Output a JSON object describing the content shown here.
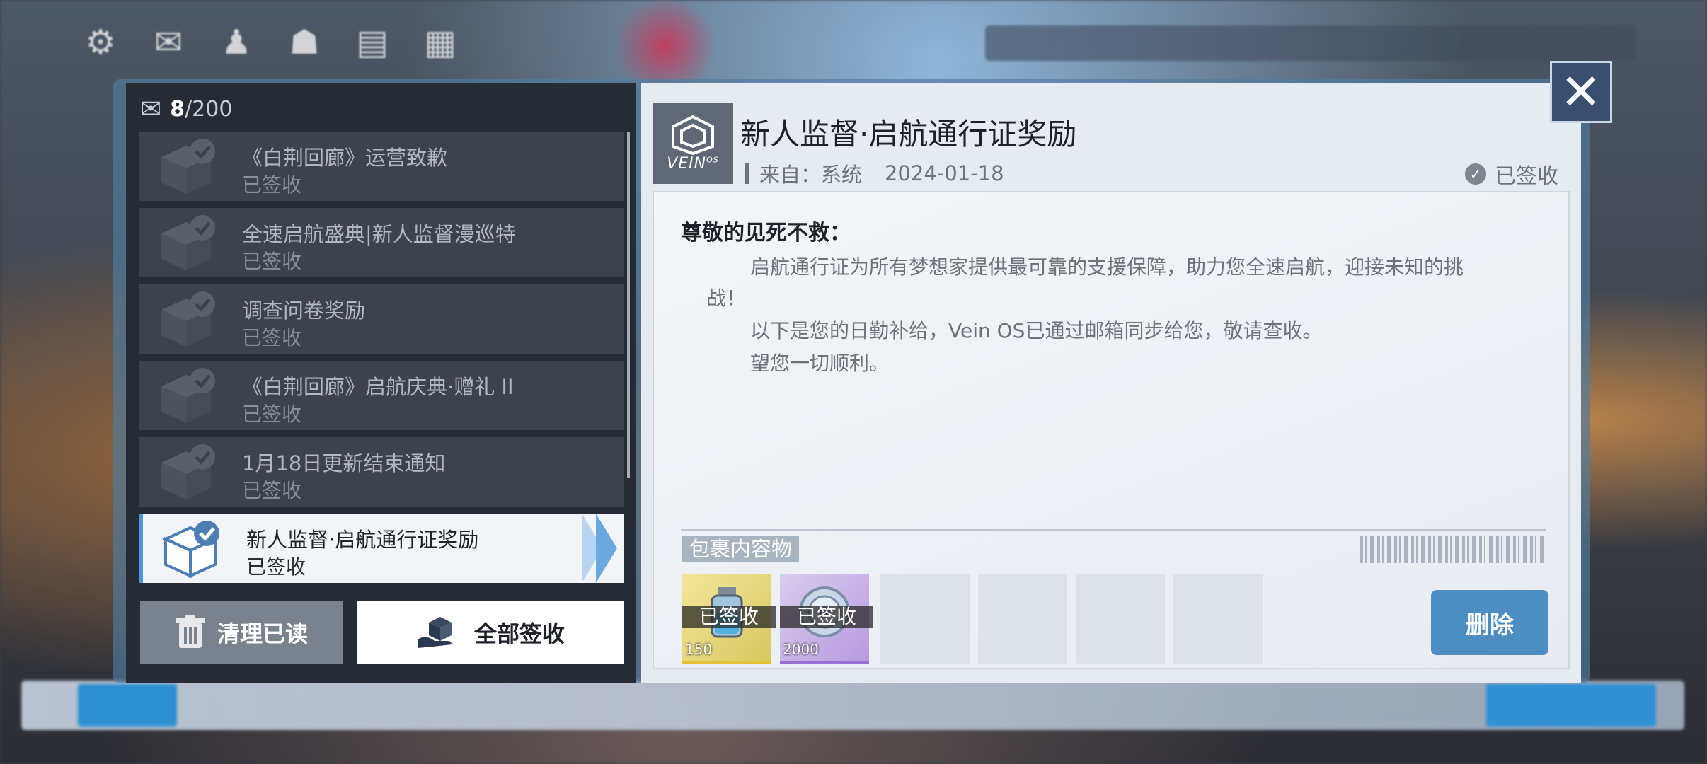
{
  "mailbox": {
    "count_current": "8",
    "count_total": "/200"
  },
  "mails": [
    {
      "title": "《白荆回廊》运营致歉",
      "status": "已签收",
      "active": false
    },
    {
      "title": "全速启航盛典|新人监督漫巡特",
      "status": "已签收",
      "active": false
    },
    {
      "title": "调查问卷奖励",
      "status": "已签收",
      "active": false
    },
    {
      "title": "《白荆回廊》启航庆典·赠礼 II",
      "status": "已签收",
      "active": false
    },
    {
      "title": "1月18日更新结束通知",
      "status": "已签收",
      "active": false
    },
    {
      "title": "新人监督·启航通行证奖励",
      "status": "已签收",
      "active": true
    }
  ],
  "buttons": {
    "clear_read": "清理已读",
    "claim_all": "全部签收",
    "delete": "删除"
  },
  "detail": {
    "logo_text": "VEIN",
    "logo_sup": "OS",
    "title": "新人监督·启航通行证奖励",
    "from_label": "来自：",
    "from_value": "系统",
    "date": "2024-01-18",
    "signed_status": "已签收",
    "greeting": "尊敬的见死不救：",
    "para1_line1": "启航通行证为所有梦想家提供最可靠的支援保障，助力您全速启航，迎接未知的挑",
    "para1_line2": "战！",
    "para2": "以下是您的日勤补给，Vein OS已通过邮箱同步给您，敬请查收。",
    "para3": "望您一切顺利。",
    "package_label": "包裹内容物"
  },
  "package_items": [
    {
      "overlay": "已签收",
      "qty": "150",
      "rarity_color": "#e4c33a"
    },
    {
      "overlay": "已签收",
      "qty": "2000",
      "rarity_color": "#9a6fd6"
    }
  ],
  "colors": {
    "accent_blue": "#4b95d8",
    "delete_button": "#4d8ec2"
  }
}
